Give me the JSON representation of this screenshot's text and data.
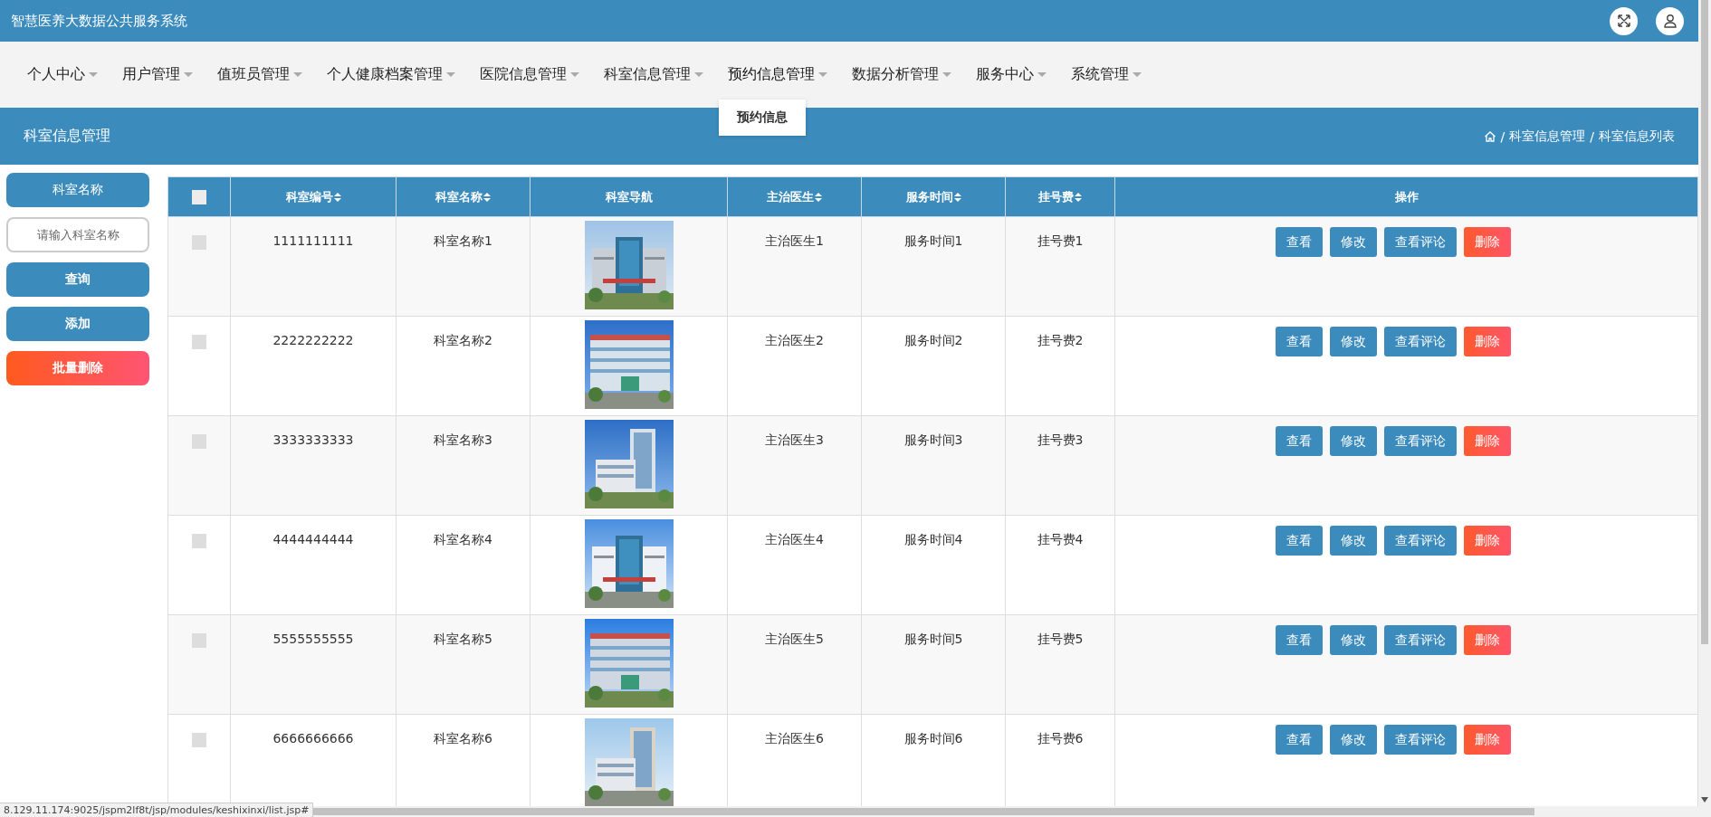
{
  "app_title": "智慧医养大数据公共服务系统",
  "nav": [
    {
      "label": "个人中心",
      "expanded": false
    },
    {
      "label": "用户管理",
      "expanded": false
    },
    {
      "label": "值班员管理",
      "expanded": false
    },
    {
      "label": "个人健康档案管理",
      "expanded": false
    },
    {
      "label": "医院信息管理",
      "expanded": false
    },
    {
      "label": "科室信息管理",
      "expanded": false
    },
    {
      "label": "预约信息管理",
      "expanded": true,
      "menu": [
        "预约信息"
      ]
    },
    {
      "label": "数据分析管理",
      "expanded": false
    },
    {
      "label": "服务中心",
      "expanded": false
    },
    {
      "label": "系统管理",
      "expanded": false
    }
  ],
  "page_title": "科室信息管理",
  "breadcrumb": [
    {
      "separator": "/",
      "label": "科室信息管理"
    },
    {
      "separator": "/",
      "label": "科室信息列表"
    }
  ],
  "search": {
    "label": "科室名称",
    "placeholder": "请输入科室名称",
    "buttons": [
      {
        "label": "查询",
        "kind": "primary"
      },
      {
        "label": "添加",
        "kind": "primary"
      },
      {
        "label": "批量删除",
        "kind": "danger"
      }
    ]
  },
  "table": {
    "select_all": {
      "checked": false
    },
    "columns": [
      {
        "label": "科室编号",
        "sortable": true
      },
      {
        "label": "科室名称",
        "sortable": true
      },
      {
        "label": "科室导航",
        "sortable": false
      },
      {
        "label": "主治医生",
        "sortable": true
      },
      {
        "label": "服务时间",
        "sortable": true
      },
      {
        "label": "挂号费",
        "sortable": true
      },
      {
        "label": "操作",
        "sortable": false
      }
    ],
    "rows": [
      {
        "checked": false,
        "id": "1111111111",
        "name": "科室名称1",
        "doctor": "主治医生1",
        "service_time": "服务时间1",
        "fee": "挂号费1",
        "actions": [
          {
            "label": "查看",
            "kind": "primary"
          },
          {
            "label": "修改",
            "kind": "primary"
          },
          {
            "label": "查看评论",
            "kind": "primary"
          },
          {
            "label": "删除",
            "kind": "danger"
          }
        ]
      },
      {
        "checked": false,
        "id": "2222222222",
        "name": "科室名称2",
        "doctor": "主治医生2",
        "service_time": "服务时间2",
        "fee": "挂号费2",
        "actions": [
          {
            "label": "查看",
            "kind": "primary"
          },
          {
            "label": "修改",
            "kind": "primary"
          },
          {
            "label": "查看评论",
            "kind": "primary"
          },
          {
            "label": "删除",
            "kind": "danger"
          }
        ]
      },
      {
        "checked": false,
        "id": "3333333333",
        "name": "科室名称3",
        "doctor": "主治医生3",
        "service_time": "服务时间3",
        "fee": "挂号费3",
        "actions": [
          {
            "label": "查看",
            "kind": "primary"
          },
          {
            "label": "修改",
            "kind": "primary"
          },
          {
            "label": "查看评论",
            "kind": "primary"
          },
          {
            "label": "删除",
            "kind": "danger"
          }
        ]
      },
      {
        "checked": false,
        "id": "4444444444",
        "name": "科室名称4",
        "doctor": "主治医生4",
        "service_time": "服务时间4",
        "fee": "挂号费4",
        "actions": [
          {
            "label": "查看",
            "kind": "primary"
          },
          {
            "label": "修改",
            "kind": "primary"
          },
          {
            "label": "查看评论",
            "kind": "primary"
          },
          {
            "label": "删除",
            "kind": "danger"
          }
        ]
      },
      {
        "checked": false,
        "id": "5555555555",
        "name": "科室名称5",
        "doctor": "主治医生5",
        "service_time": "服务时间5",
        "fee": "挂号费5",
        "actions": [
          {
            "label": "查看",
            "kind": "primary"
          },
          {
            "label": "修改",
            "kind": "primary"
          },
          {
            "label": "查看评论",
            "kind": "primary"
          },
          {
            "label": "删除",
            "kind": "danger"
          }
        ]
      },
      {
        "checked": false,
        "id": "6666666666",
        "name": "科室名称6",
        "doctor": "主治医生6",
        "service_time": "服务时间6",
        "fee": "挂号费6",
        "actions": [
          {
            "label": "查看",
            "kind": "primary"
          },
          {
            "label": "修改",
            "kind": "primary"
          },
          {
            "label": "查看评论",
            "kind": "primary"
          },
          {
            "label": "删除",
            "kind": "danger"
          }
        ]
      }
    ]
  },
  "status_url": "8.129.11.174:9025/jspm2lf8t/jsp/modules/keshixinxi/list.jsp#"
}
